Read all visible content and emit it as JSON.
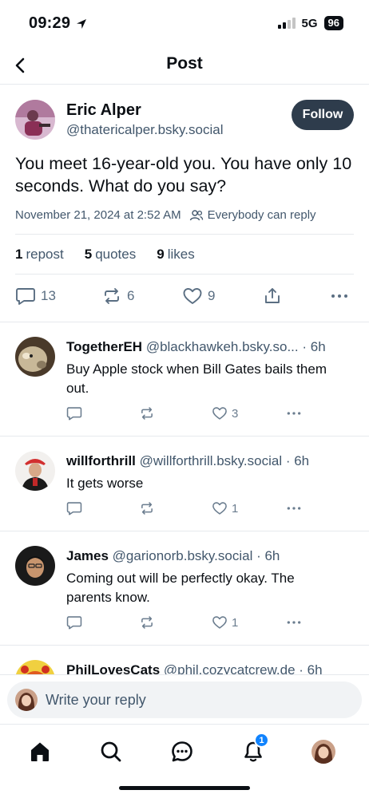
{
  "status_bar": {
    "time": "09:29",
    "network": "5G",
    "battery": "96"
  },
  "header": {
    "title": "Post"
  },
  "post": {
    "author_name": "Eric Alper",
    "author_handle": "@thatericalper.bsky.social",
    "follow_label": "Follow",
    "text": "You meet 16-year-old you. You have only 10 seconds. What do you say?",
    "timestamp": "November 21, 2024 at 2:52 AM",
    "reply_permission": "Everybody can reply",
    "stats": {
      "reposts_count": "1",
      "reposts_label": "repost",
      "quotes_count": "5",
      "quotes_label": "quotes",
      "likes_count": "9",
      "likes_label": "likes"
    },
    "actions": {
      "replies": "13",
      "reposts": "6",
      "likes": "9"
    }
  },
  "replies": [
    {
      "name": "TogetherEH",
      "handle": "@blackhawkeh.bsky.so...",
      "time": "· 6h",
      "text": "Buy Apple stock when Bill Gates bails them out.",
      "replies": "",
      "reposts": "",
      "likes": "3"
    },
    {
      "name": "willforthrill",
      "handle": "@willforthrill.bsky.social",
      "time": "· 6h",
      "text": "It gets worse",
      "replies": "",
      "reposts": "",
      "likes": "1"
    },
    {
      "name": "James",
      "handle": "@garionorb.bsky.social",
      "time": "· 6h",
      "text": "Coming out will be perfectly okay. The parents know.",
      "replies": "",
      "reposts": "",
      "likes": "1"
    },
    {
      "name": "PhilLovesCats",
      "handle": "@phil.cozycatcrew.de",
      "time": "· 6h",
      "text": "",
      "replies": "",
      "reposts": "",
      "likes": ""
    }
  ],
  "composer": {
    "placeholder": "Write your reply"
  },
  "tabbar": {
    "items": [
      "home-icon",
      "search-icon",
      "chat-icon",
      "bell-icon",
      "profile-avatar"
    ],
    "notification_badge": "1"
  },
  "colors": {
    "accent": "#1083fe",
    "follow_button": "#2e3c4c",
    "secondary_text": "#42576c"
  }
}
